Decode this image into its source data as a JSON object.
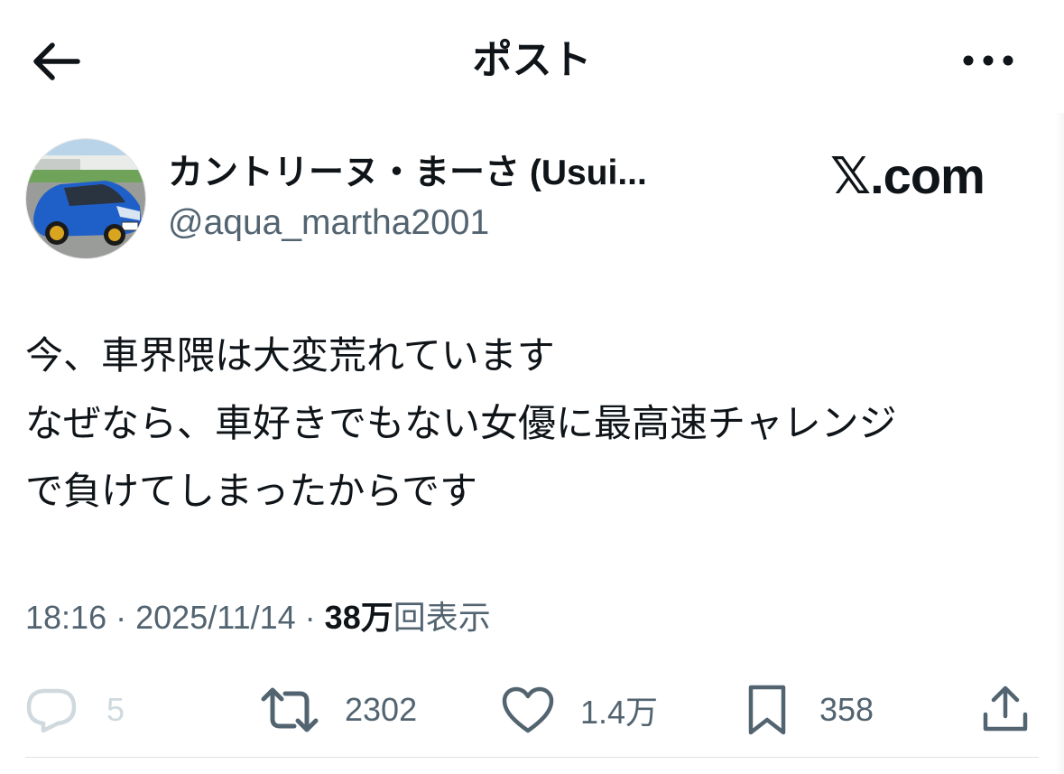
{
  "header": {
    "title": "ポスト"
  },
  "post": {
    "author_name": "カントリーヌ・まーさ (Usui...",
    "author_handle": "@aqua_martha2001",
    "watermark": "𝕏.com",
    "lines": [
      "今、車界隈は大変荒れています",
      "なぜなら、車好きでもない女優に最高速チャレンジ",
      "で負けてしまったからです"
    ],
    "time": "18:16",
    "date": "2025/11/14",
    "views_number": "38万",
    "views_label": "回表示",
    "separator": "·"
  },
  "actions": {
    "replies": "5",
    "reposts": "2302",
    "likes": "1.4万",
    "bookmarks": "358"
  },
  "icons": {
    "back": "back-arrow-icon",
    "more": "more-icon",
    "reply": "reply-icon",
    "repost": "repost-icon",
    "like": "heart-icon",
    "bookmark": "bookmark-icon",
    "share": "share-icon"
  },
  "colors": {
    "text": "#0f1419",
    "secondary": "#536471",
    "muted": "#cfd9de",
    "divider": "#dfe3e6",
    "car_blue": "#1f5fc8",
    "wheel_gold": "#d9a520"
  }
}
